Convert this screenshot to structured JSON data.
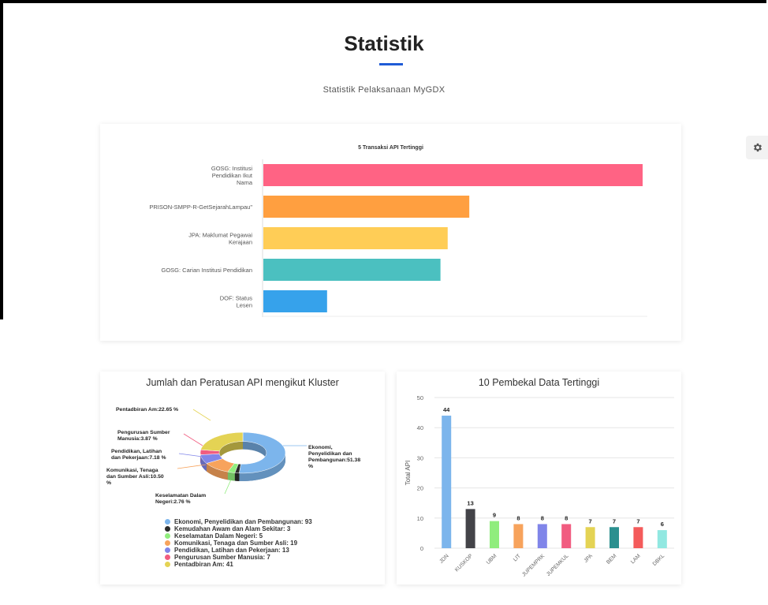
{
  "page": {
    "title": "Statistik",
    "subtitle": "Statistik Pelaksanaan MyGDX",
    "accent_color": "#1f5bd6"
  },
  "settings": {
    "icon": "gear-icon"
  },
  "top_chart": {
    "chart_data": {
      "type": "bar",
      "orientation": "horizontal",
      "title": "5 Transaksi API Tertinggi",
      "categories": [
        "GOSG: Institusi Pendidikan Ikut Nama",
        "PRISON-SMPP-R-GetSejarahLampau\"",
        "JPA: Maklumat Pegawai Kerajaan",
        "GOSG: Carian Institusi Pendidikan",
        "DOF: Status Lesen"
      ],
      "category_lines": [
        [
          "GOSG: Institusi",
          "Pendidikan Ikut",
          "Nama"
        ],
        [
          "PRISON-SMPP-R-GetSejarahLampau\""
        ],
        [
          "JPA: Maklumat Pegawai",
          "Kerajaan"
        ],
        [
          "GOSG: Carian Institusi Pendidikan"
        ],
        [
          "DOF: Status",
          "Lesen"
        ]
      ],
      "values": [
        100,
        54.3,
        48.6,
        46.7,
        16.8
      ],
      "colors": [
        "#ff6384",
        "#ff9f40",
        "#ffcd56",
        "#4bc0c0",
        "#36a2eb"
      ],
      "grid": false
    }
  },
  "pie_chart": {
    "title": "Jumlah dan Peratusan API mengikut Kluster",
    "chart_data": {
      "type": "pie",
      "variant": "3d-donut",
      "title": "Jumlah dan Peratusan API mengikut Kluster",
      "slices": [
        {
          "name": "Ekonomi, Penyelidikan dan Pembangunan",
          "value": 93,
          "percent": 51.38,
          "color": "#7cb5ec"
        },
        {
          "name": "Kemudahan Awam dan Alam Sekitar",
          "value": 3,
          "percent": 1.66,
          "color": "#2b2b2b"
        },
        {
          "name": "Keselamatan Dalam Negeri",
          "value": 5,
          "percent": 2.76,
          "color": "#90ed7d"
        },
        {
          "name": "Komunikasi, Tenaga dan Sumber Asli",
          "value": 19,
          "percent": 10.5,
          "color": "#f7a35c"
        },
        {
          "name": "Pendidikan, Latihan dan Pekerjaan",
          "value": 13,
          "percent": 7.18,
          "color": "#8085e9"
        },
        {
          "name": "Pengurusan Sumber Manusia",
          "value": 7,
          "percent": 3.87,
          "color": "#f15c80"
        },
        {
          "name": "Pentadbiran Am",
          "value": 41,
          "percent": 22.65,
          "color": "#e4d354"
        }
      ],
      "data_labels": [
        [
          "Ekonomi,",
          "Penyelidikan dan",
          "Pembangunan:51.38",
          "%"
        ],
        [
          "Keselamatan Dalam",
          "Negeri:2.76 %"
        ],
        [
          "Komunikasi, Tenaga",
          "dan Sumber Asli:10.50",
          "%"
        ],
        [
          "Pendidikan, Latihan",
          "dan Pekerjaan:7.18 %"
        ],
        [
          "Pengurusan Sumber",
          "Manusia:3.87 %"
        ],
        [
          "Pentadbiran Am:22.65 %"
        ]
      ],
      "legend": [
        "Ekonomi, Penyelidikan dan Pembangunan: 93",
        "Kemudahan Awam dan Alam Sekitar: 3",
        "Keselamatan Dalam Negeri: 5",
        "Komunikasi, Tenaga dan Sumber Asli: 19",
        "Pendidikan, Latihan dan Pekerjaan: 13",
        "Pengurusan Sumber Manusia: 7",
        "Pentadbiran Am: 41"
      ],
      "legend_placement": "bottom"
    }
  },
  "column_chart": {
    "title": "10 Pembekal Data Tertinggi",
    "chart_data": {
      "type": "bar",
      "title": "10 Pembekal Data Tertinggi",
      "ylabel": "Total API",
      "ylim": [
        0,
        50
      ],
      "yticks": [
        0,
        10,
        20,
        30,
        40,
        50
      ],
      "categories": [
        "JDN",
        "KUSKOP",
        "UBM",
        "LIT",
        "JUPEMPRK",
        "JUPEMKUL",
        "JPA",
        "BEM",
        "LAM",
        "DBKL"
      ],
      "values": [
        44,
        13,
        9,
        8,
        8,
        8,
        7,
        7,
        7,
        6
      ],
      "colors": [
        "#7cb5ec",
        "#434348",
        "#90ed7d",
        "#f7a35c",
        "#8085e9",
        "#f15c80",
        "#e4d354",
        "#2b908f",
        "#f45b5b",
        "#91e8e1"
      ],
      "grid": true
    }
  }
}
